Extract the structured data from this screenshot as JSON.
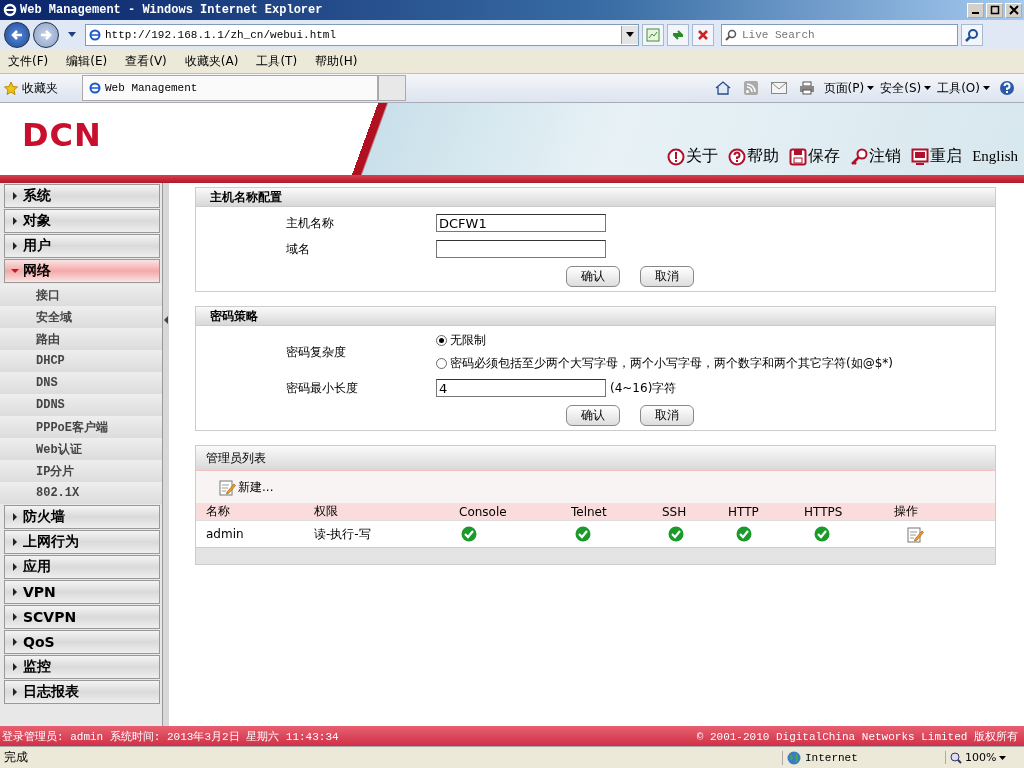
{
  "window": {
    "title": "Web Management - Windows Internet Explorer"
  },
  "browser": {
    "address": "http://192.168.1.1/zh_cn/webui.html",
    "search_placeholder": "Live Search",
    "menu": [
      "文件(F)",
      "编辑(E)",
      "查看(V)",
      "收藏夹(A)",
      "工具(T)",
      "帮助(H)"
    ],
    "favorites": "收藏夹",
    "tab": "Web Management",
    "commands": [
      "页面(P)",
      "安全(S)",
      "工具(O)"
    ]
  },
  "header": {
    "logo": "DCN",
    "links": [
      {
        "kind": "about",
        "label": "关于"
      },
      {
        "kind": "help",
        "label": "帮助"
      },
      {
        "kind": "save",
        "label": "保存"
      },
      {
        "kind": "logout",
        "label": "注销"
      },
      {
        "kind": "restart",
        "label": "重启"
      }
    ],
    "language": "English"
  },
  "sidebar": {
    "items": [
      {
        "label": "系统",
        "expanded": false
      },
      {
        "label": "对象",
        "expanded": false
      },
      {
        "label": "用户",
        "expanded": false
      },
      {
        "label": "网络",
        "expanded": true,
        "children": [
          {
            "label": "接口"
          },
          {
            "label": "安全域"
          },
          {
            "label": "路由"
          },
          {
            "label": "DHCP"
          },
          {
            "label": "DNS"
          },
          {
            "label": "DDNS"
          },
          {
            "label": "PPPoE客户端"
          },
          {
            "label": "Web认证"
          },
          {
            "label": "IP分片"
          },
          {
            "label": "802.1X"
          }
        ]
      },
      {
        "label": "防火墙",
        "expanded": false
      },
      {
        "label": "上网行为",
        "expanded": false
      },
      {
        "label": "应用",
        "expanded": false
      },
      {
        "label": "VPN",
        "expanded": false
      },
      {
        "label": "SCVPN",
        "expanded": false
      },
      {
        "label": "QoS",
        "expanded": false
      },
      {
        "label": "监控",
        "expanded": false
      },
      {
        "label": "日志报表",
        "expanded": false
      }
    ]
  },
  "hostname_config": {
    "title": "主机名称配置",
    "fields": [
      {
        "label": "主机名称",
        "value": "DCFW1"
      },
      {
        "label": "域名"
      }
    ],
    "buttons": [
      "确认",
      "取消"
    ]
  },
  "password_policy": {
    "title": "密码策略",
    "complexity_label": "密码复杂度",
    "options": [
      {
        "label": "无限制",
        "selected": true
      },
      {
        "label": "密码必须包括至少两个大写字母，两个小写字母，两个数字和两个其它字符(如@$*)",
        "selected": false
      }
    ],
    "min_length_label": "密码最小长度",
    "min_length_value": "4",
    "min_length_hint": "(4~16)字符",
    "buttons": [
      "确认",
      "取消"
    ]
  },
  "admin_list": {
    "title": "管理员列表",
    "new_label": "新建...",
    "columns": [
      "名称",
      "权限",
      "Console",
      "Telnet",
      "SSH",
      "HTTP",
      "HTTPS",
      "操作"
    ],
    "rows": [
      {
        "name": "admin",
        "permission": "读-执行-写",
        "access": [
          true,
          true,
          true,
          true,
          true
        ]
      }
    ]
  },
  "footer": {
    "login_info": "登录管理员: admin 系统时间: 2013年3月2日 星期六 11:43:34",
    "copyright": "© 2001-2010 DigitalChina Networks Limited 版权所有"
  },
  "status_bar": {
    "status": "完成",
    "zone": "Internet",
    "zoom": "100%"
  }
}
